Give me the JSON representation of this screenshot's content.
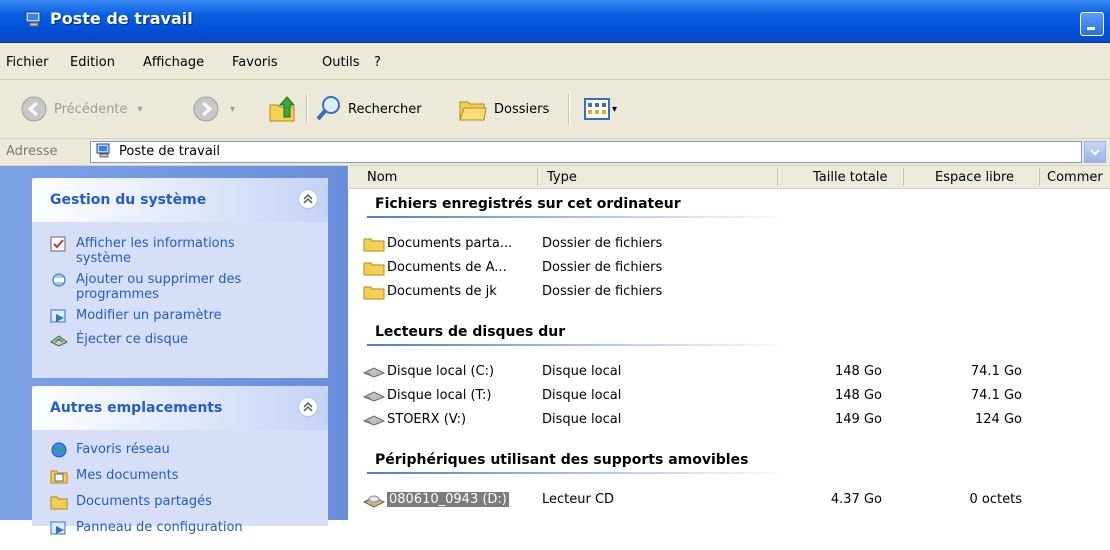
{
  "window": {
    "title": "Poste de travail"
  },
  "menu": {
    "items": [
      "Fichier",
      "Edition",
      "Affichage",
      "Favoris",
      "Outils",
      "?"
    ]
  },
  "toolbar": {
    "back": "Précédente",
    "search": "Rechercher",
    "folders": "Dossiers"
  },
  "address": {
    "label": "Adresse",
    "value": "Poste de travail"
  },
  "tasks": {
    "system": {
      "title": "Gestion du système",
      "items": [
        "Afficher les informations\nsystème",
        "Ajouter ou supprimer des\nprogrammes",
        "Modifier un paramètre",
        "Éjecter ce disque"
      ]
    },
    "places": {
      "title": "Autres emplacements",
      "items": [
        "Favoris réseau",
        "Mes documents",
        "Documents partagés",
        "Panneau de configuration"
      ]
    }
  },
  "columns": {
    "name": "Nom",
    "type": "Type",
    "total": "Taille totale",
    "free": "Espace libre",
    "comment": "Commer"
  },
  "groups": {
    "files": {
      "title": "Fichiers enregistrés sur cet ordinateur",
      "rows": [
        {
          "name": "Documents parta...",
          "type": "Dossier de fichiers"
        },
        {
          "name": "Documents de A...",
          "type": "Dossier de fichiers"
        },
        {
          "name": "Documents de jk",
          "type": "Dossier de fichiers"
        }
      ]
    },
    "disks": {
      "title": "Lecteurs de disques dur",
      "rows": [
        {
          "name": "Disque local (C:)",
          "type": "Disque local",
          "total": "148 Go",
          "free": "74.1 Go"
        },
        {
          "name": "Disque local (T:)",
          "type": "Disque local",
          "total": "148 Go",
          "free": "74.1 Go"
        },
        {
          "name": "STOERX (V:)",
          "type": "Disque local",
          "total": "149 Go",
          "free": "124 Go"
        }
      ]
    },
    "removable": {
      "title": "Périphériques utilisant des supports amovibles",
      "rows": [
        {
          "name": "080610_0943 (D:)",
          "type": "Lecteur CD",
          "total": "4.37 Go",
          "free": "0 octets"
        }
      ]
    }
  },
  "colors": {
    "title_blue": "#0050d8",
    "task_blue": "#215dc6",
    "pane_bg": "#7ba2e7"
  }
}
